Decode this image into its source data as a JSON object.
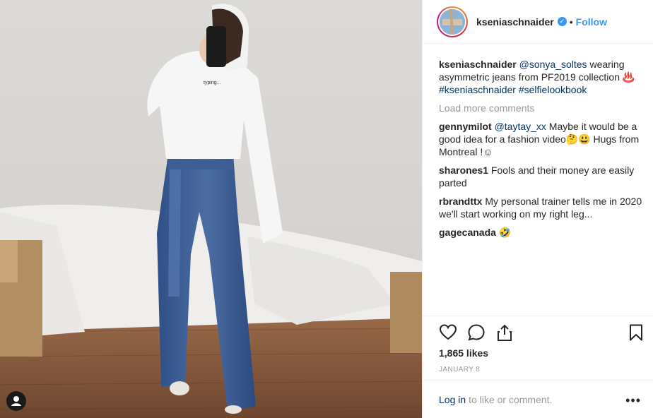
{
  "post": {
    "username": "kseniaschnaider",
    "follow_label": "Follow",
    "caption_user": "kseniaschnaider",
    "caption_mention": "@sonya_soltes",
    "caption_text": " wearing asymmetric jeans from PF2019 collection ♨️ ",
    "caption_tag1": "#kseniaschnaider",
    "caption_tag2": "#selfielookbook",
    "load_more": "Load more comments",
    "likes": "1,865 likes",
    "date": "JANUARY 8",
    "login_link": "Log in",
    "login_text": "to like or comment.",
    "more_menu": "•••",
    "hoodie_text": "typing..."
  },
  "comments": [
    {
      "user": "gennymilot",
      "mention": "@taytay_xx",
      "text": " Maybe it would be a good idea for a fashion video🤔😃 Hugs from Montreal !☺"
    },
    {
      "user": "sharones1",
      "mention": "",
      "text": " Fools and their money are easily parted"
    },
    {
      "user": "rbrandttx",
      "mention": "",
      "text": " My personal trainer tells me in 2020 we'll start working on my right leg..."
    },
    {
      "user": "gagecanada",
      "mention": "",
      "text": " 🤣"
    }
  ],
  "icons": [
    "heart-icon",
    "comment-icon",
    "share-icon",
    "bookmark-icon",
    "verified-badge-icon",
    "user-tag-icon"
  ],
  "colors": {
    "accent": "#3897f0",
    "link": "#003569",
    "muted": "#999999",
    "text": "#262626"
  }
}
